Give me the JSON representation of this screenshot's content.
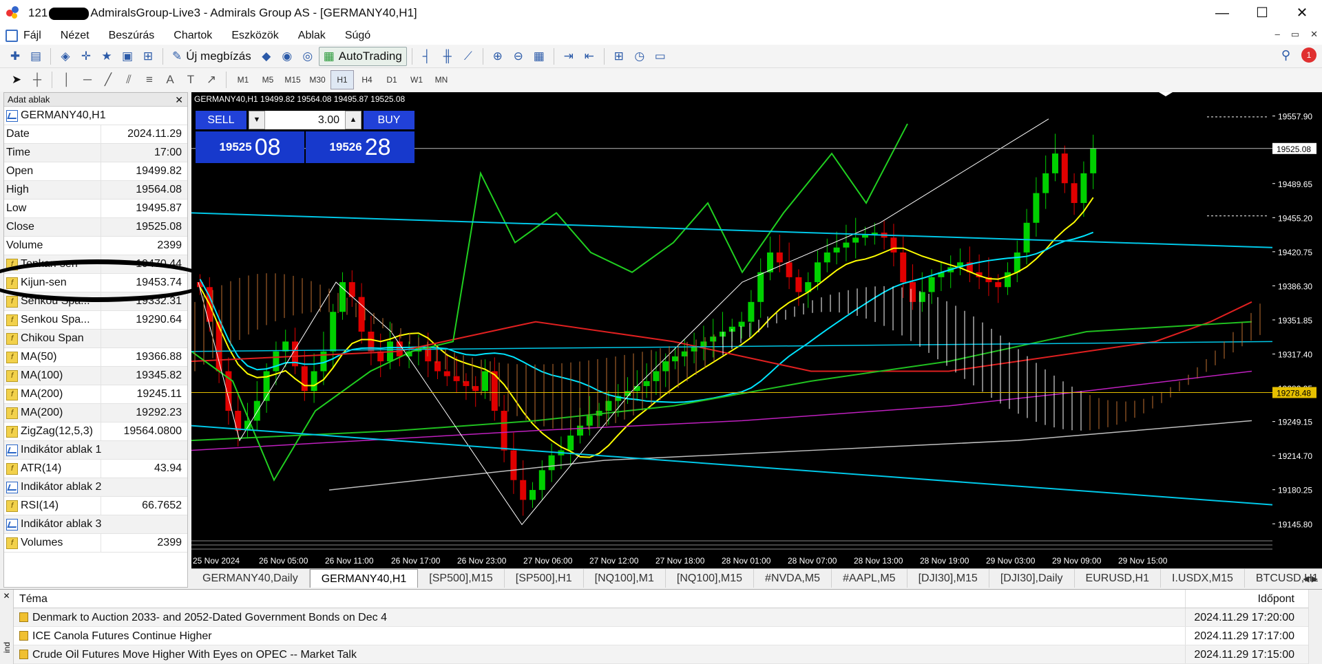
{
  "window": {
    "title_prefix": "121",
    "title_rest": "AdmiralsGroup-Live3 - Admirals Group AS - [GERMANY40,H1]",
    "min": "—",
    "max": "☐",
    "close": "✕"
  },
  "menu": [
    "Fájl",
    "Nézet",
    "Beszúrás",
    "Chartok",
    "Eszközök",
    "Ablak",
    "Súgó"
  ],
  "toolbar": {
    "new_order": "Új megbízás",
    "autotrading": "AutoTrading",
    "notification_count": "1"
  },
  "timeframes": [
    "M1",
    "M5",
    "M15",
    "M30",
    "H1",
    "H4",
    "D1",
    "W1",
    "MN"
  ],
  "data_window": {
    "title": "Adat ablak",
    "symbol": "GERMANY40,H1",
    "rows": [
      {
        "name": "Date",
        "value": "2024.11.29"
      },
      {
        "name": "Time",
        "value": "17:00"
      },
      {
        "name": "Open",
        "value": "19499.82"
      },
      {
        "name": "High",
        "value": "19564.08"
      },
      {
        "name": "Low",
        "value": "19495.87"
      },
      {
        "name": "Close",
        "value": "19525.08"
      },
      {
        "name": "Volume",
        "value": "2399"
      },
      {
        "name": "Tenkan-sen",
        "value": "19470.44"
      },
      {
        "name": "Kijun-sen",
        "value": "19453.74"
      },
      {
        "name": "Senkou Spa...",
        "value": "19332.31"
      },
      {
        "name": "Senkou Spa...",
        "value": "19290.64"
      },
      {
        "name": "Chikou Span",
        "value": ""
      },
      {
        "name": "MA(50)",
        "value": "19366.88"
      },
      {
        "name": "MA(100)",
        "value": "19345.82"
      },
      {
        "name": "MA(200)",
        "value": "19245.11"
      },
      {
        "name": "MA(200)",
        "value": "19292.23"
      },
      {
        "name": "ZigZag(12,5,3)",
        "value": "19564.0800"
      },
      {
        "name": "Indikátor ablak 1",
        "value": ""
      },
      {
        "name": "ATR(14)",
        "value": "43.94"
      },
      {
        "name": "Indikátor ablak 2",
        "value": ""
      },
      {
        "name": "RSI(14)",
        "value": "66.7652"
      },
      {
        "name": "Indikátor ablak 3",
        "value": ""
      },
      {
        "name": "Volumes",
        "value": "2399"
      }
    ]
  },
  "chart": {
    "ohlc_label": "GERMANY40,H1  19499.82  19564.08  19495.87  19525.08",
    "sell": "SELL",
    "buy": "BUY",
    "volume": "3.00",
    "sell_big": "19525",
    "sell_small": "08",
    "buy_big": "19526",
    "buy_small": "28",
    "price_axis": [
      "19557.90",
      "19489.65",
      "19455.20",
      "19420.75",
      "19386.30",
      "19351.85",
      "19317.40",
      "19282.95",
      "19249.15",
      "19214.70",
      "19180.25",
      "19145.80"
    ],
    "current_price": "19525.08",
    "yellow_price": "19278.48",
    "time_axis": [
      "25 Nov 2024",
      "26 Nov 05:00",
      "26 Nov 11:00",
      "26 Nov 17:00",
      "26 Nov 23:00",
      "27 Nov 06:00",
      "27 Nov 12:00",
      "27 Nov 18:00",
      "28 Nov 01:00",
      "28 Nov 07:00",
      "28 Nov 13:00",
      "28 Nov 19:00",
      "29 Nov 03:00",
      "29 Nov 09:00",
      "29 Nov 15:00"
    ],
    "colors": {
      "bull": "#00d000",
      "bear": "#e00000",
      "tenkan": "#ffff00",
      "kijun": "#00e5ff",
      "ma_red": "#e02020",
      "ma_green": "#20c020",
      "ma_magenta": "#c020c0",
      "ma_grey": "#c0c0c0",
      "chikou": "#20d020",
      "zigzag": "#ffffff",
      "channel": "#00c8e8"
    }
  },
  "chart_tabs": [
    "GERMANY40,Daily",
    "GERMANY40,H1",
    "[SP500],M15",
    "[SP500],H1",
    "[NQ100],M1",
    "[NQ100],M15",
    "#NVDA,M5",
    "#AAPL,M5",
    "[DJI30],M15",
    "[DJI30],Daily",
    "EURUSD,H1",
    "I.USDX,M15",
    "BTCUSD,H1"
  ],
  "news": {
    "col_topic": "Téma",
    "col_time": "Időpont",
    "side_label": "ind",
    "rows": [
      {
        "topic": "Denmark to Auction 2033- and 2052-Dated Government Bonds on Dec 4",
        "time": "2024.11.29 17:20:00"
      },
      {
        "topic": "ICE Canola Futures Continue Higher",
        "time": "2024.11.29 17:17:00"
      },
      {
        "topic": "Crude Oil Futures Move Higher With Eyes on OPEC -- Market Talk",
        "time": "2024.11.29 17:15:00"
      }
    ]
  }
}
